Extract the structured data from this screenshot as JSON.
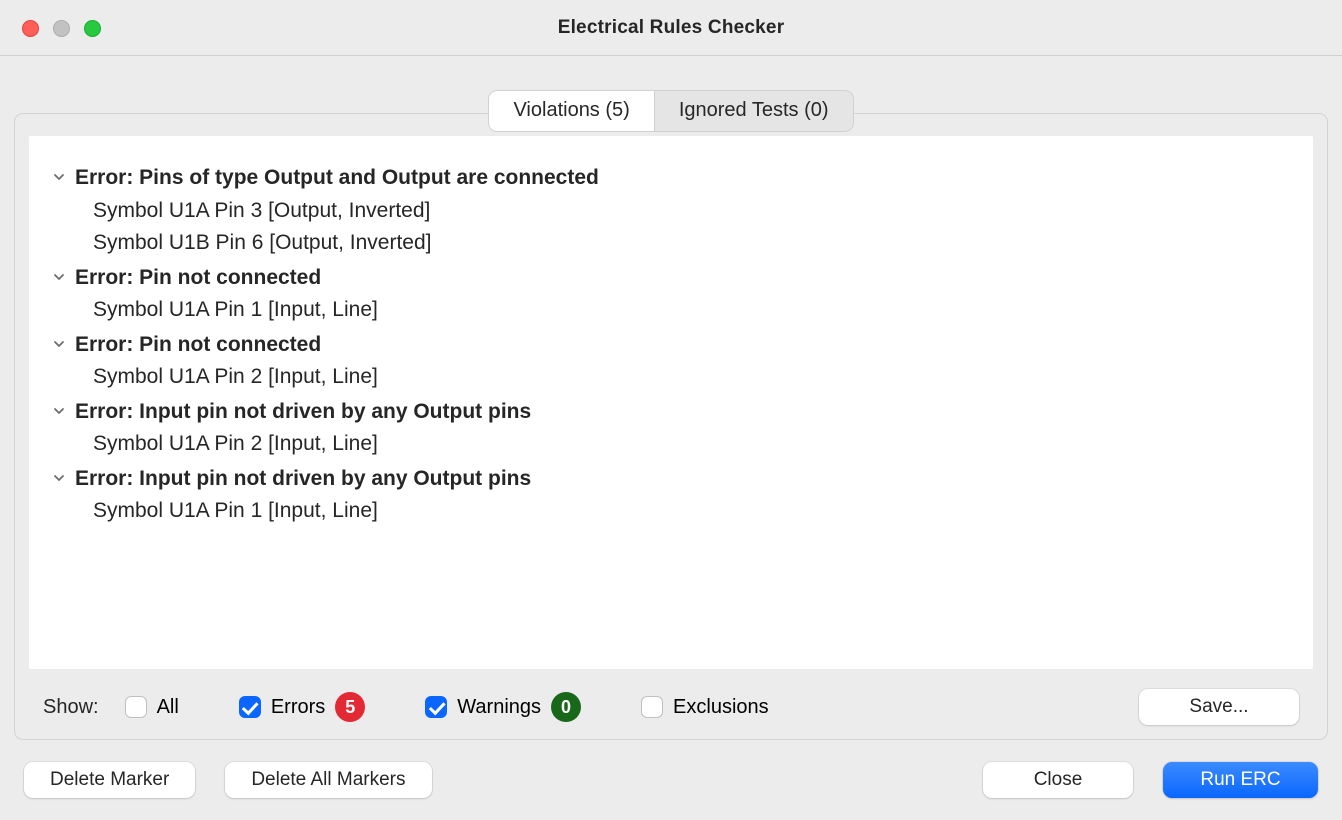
{
  "window": {
    "title": "Electrical Rules Checker"
  },
  "tabs": {
    "violations": "Violations (5)",
    "ignored": "Ignored Tests (0)"
  },
  "violations": [
    {
      "title": "Error: Pins of type Output and Output are connected",
      "details": [
        "Symbol U1A Pin 3 [Output, Inverted]",
        "Symbol U1B Pin 6 [Output, Inverted]"
      ]
    },
    {
      "title": "Error: Pin not connected",
      "details": [
        "Symbol U1A Pin 1 [Input, Line]"
      ]
    },
    {
      "title": "Error: Pin not connected",
      "details": [
        "Symbol U1A Pin 2 [Input, Line]"
      ]
    },
    {
      "title": "Error: Input pin not driven by any Output pins",
      "details": [
        "Symbol U1A Pin 2 [Input, Line]"
      ]
    },
    {
      "title": "Error: Input pin not driven by any Output pins",
      "details": [
        "Symbol U1A Pin 1 [Input, Line]"
      ]
    }
  ],
  "filter": {
    "show_label": "Show:",
    "all_label": "All",
    "errors_label": "Errors",
    "errors_count": "5",
    "warnings_label": "Warnings",
    "warnings_count": "0",
    "exclusions_label": "Exclusions"
  },
  "buttons": {
    "save": "Save...",
    "delete_marker": "Delete Marker",
    "delete_all": "Delete All Markers",
    "close": "Close",
    "run": "Run ERC"
  }
}
